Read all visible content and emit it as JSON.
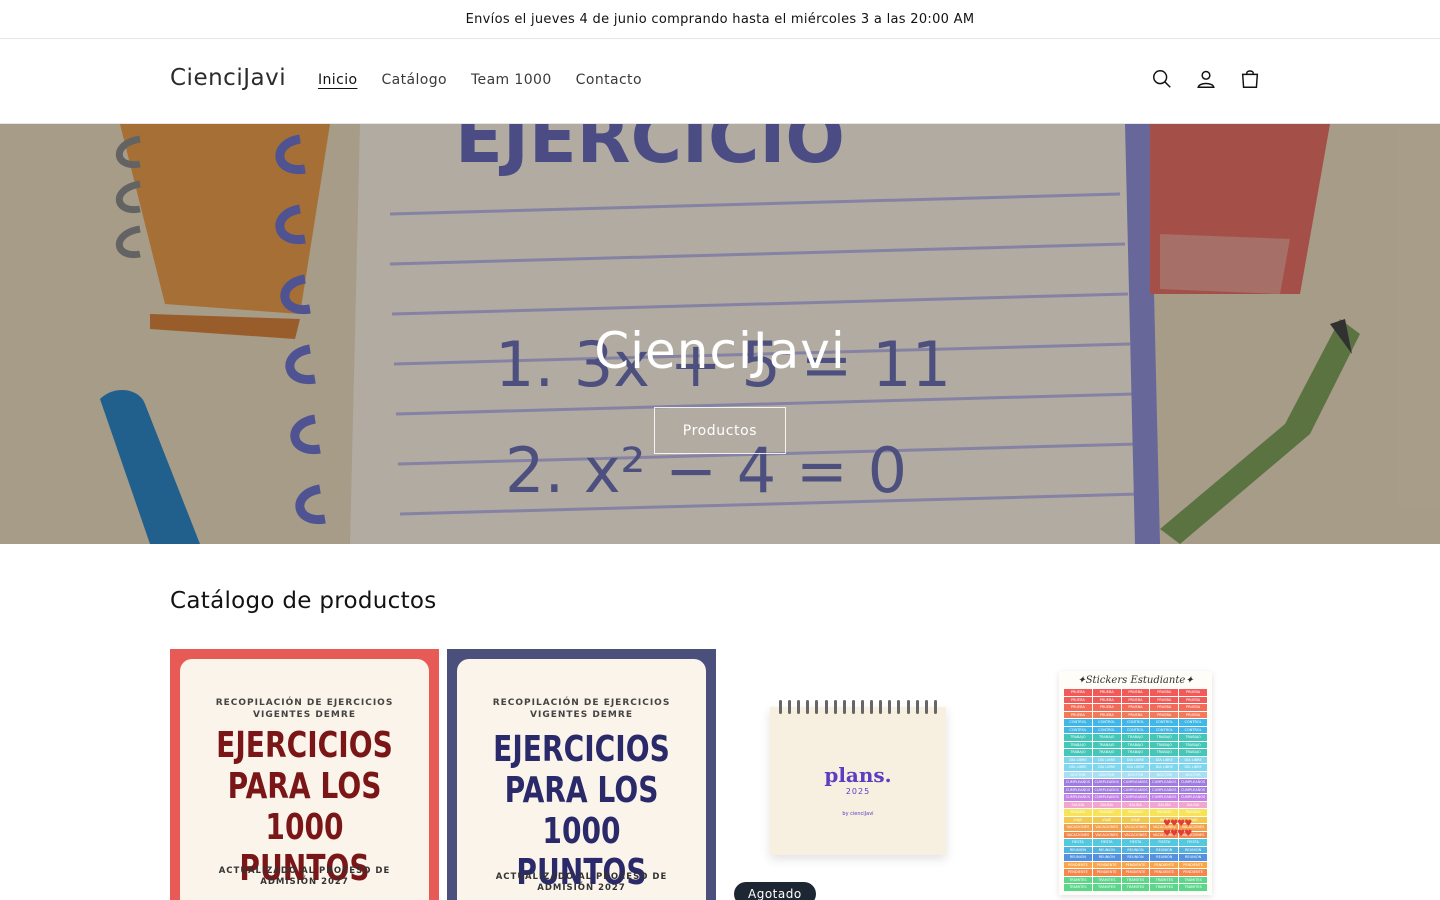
{
  "announcement": {
    "text": "Envíos el jueves 4 de junio comprando hasta el miércoles 3 a las 20:00 AM"
  },
  "header": {
    "brand": "CienciJavi",
    "nav": [
      {
        "label": "Inicio",
        "active": true
      },
      {
        "label": "Catálogo",
        "active": false
      },
      {
        "label": "Team 1000",
        "active": false
      },
      {
        "label": "Contacto",
        "active": false
      }
    ],
    "icons": [
      "search-icon",
      "account-icon",
      "cart-icon"
    ]
  },
  "hero": {
    "title": "CienciJavi",
    "button_label": "Productos",
    "art_texts": {
      "heading": "EJERCICIO",
      "eq1": "1.  3x + 5 = 11",
      "eq2": "2.  x² − 4 = 0"
    }
  },
  "catalog": {
    "title": "Catálogo de productos",
    "products": [
      {
        "kicker_line1": "RECOPILACIÓN DE EJERCICIOS",
        "kicker_line2": "VIGENTES DEMRE",
        "big_line1": "EJERCICIOS",
        "big_line2": "PARA LOS 1000",
        "big_line3": "PUNTOS",
        "foot_line1": "ACTUALIZADO AL PROCESO DE",
        "foot_line2": "ADMISIÓN 2027",
        "accent": "#e85a55"
      },
      {
        "kicker_line1": "RECOPILACIÓN DE EJERCICIOS",
        "kicker_line2": "VIGENTES DEMRE",
        "big_line1": "EJERCICIOS",
        "big_line2": "PARA LOS 1000",
        "big_line3": "PUNTOS",
        "foot_line1": "ACTUALIZADO AL PROCESO DE",
        "foot_line2": "ADMISIÓN 2027",
        "accent": "#4b4f7b"
      },
      {
        "cover_title": "plans.",
        "cover_year": "2025",
        "cover_by": "by cienciJavi",
        "badge": "Agotado"
      },
      {
        "cover_title": "✦Stickers Estudiante✦",
        "rows": [
          {
            "label": "PRUEBA",
            "color": "#f25a5a"
          },
          {
            "label": "PRUEBA",
            "color": "#f25a5a"
          },
          {
            "label": "PRUEBA",
            "color": "#f26a5a"
          },
          {
            "label": "PRUEBA",
            "color": "#f27a5a"
          },
          {
            "label": "CONTROL",
            "color": "#3fb7e8"
          },
          {
            "label": "CONTROL",
            "color": "#3fb7e8"
          },
          {
            "label": "TRABAJO",
            "color": "#44c7b9"
          },
          {
            "label": "TRABAJO",
            "color": "#44c7b9"
          },
          {
            "label": "TRABAJO",
            "color": "#44c7b9"
          },
          {
            "label": "DÍA LIBRE",
            "color": "#7fd6f0"
          },
          {
            "label": "DÍA LIBRE",
            "color": "#7fd6f0"
          },
          {
            "label": "DOCTOR",
            "color": "#a9dff2"
          },
          {
            "label": "CUMPLEAÑOS",
            "color": "#a07be0"
          },
          {
            "label": "CUMPLEAÑOS",
            "color": "#a07be0"
          },
          {
            "label": "CUMPLEAÑOS",
            "color": "#c383e6"
          },
          {
            "label": "SALIDA",
            "color": "#f2a5d2"
          },
          {
            "label": "PAGADO",
            "color": "#f7e35a"
          },
          {
            "label": "VIAJE",
            "color": "#f2c94c"
          },
          {
            "label": "VACACIONES",
            "color": "#f2a14c"
          },
          {
            "label": "VACACIONES",
            "color": "#f2894c"
          },
          {
            "label": "FIESTA",
            "color": "#53c9e0"
          },
          {
            "label": "REUNIÓN",
            "color": "#53b3e0"
          },
          {
            "label": "REUNIÓN",
            "color": "#5392e0"
          },
          {
            "label": "PENDIENTE",
            "color": "#f7a64c"
          },
          {
            "label": "PENDIENTE",
            "color": "#f7864c"
          },
          {
            "label": "TRÁMITES",
            "color": "#5cd68a"
          },
          {
            "label": "TRÁMITES",
            "color": "#5cd68a"
          }
        ],
        "hearts": "♥♥♥♥\n♥♥♥♥"
      }
    ]
  }
}
